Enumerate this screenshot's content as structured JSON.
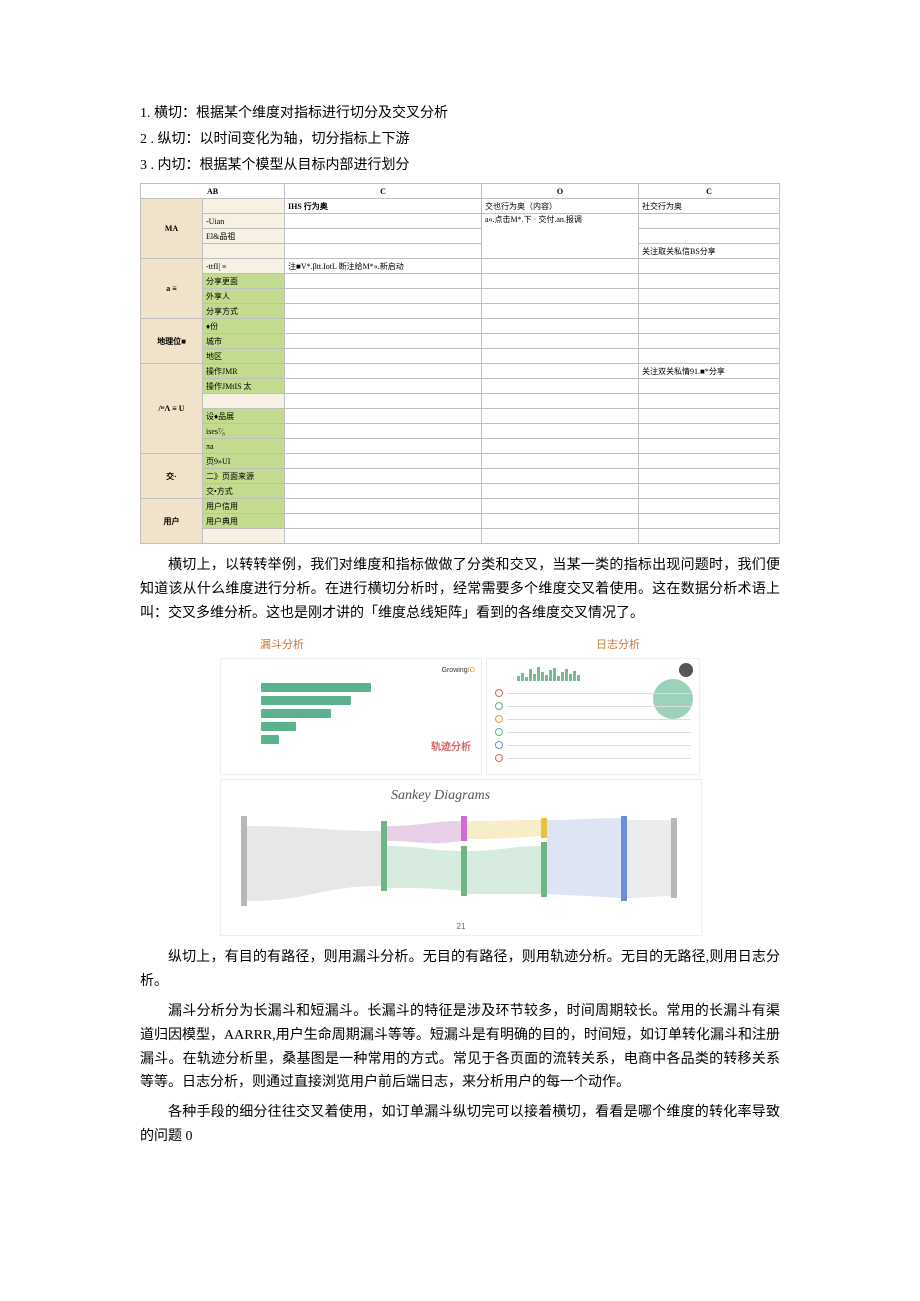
{
  "list": {
    "item1": "1. 横切：根据某个维度对指标进行切分及交叉分析",
    "item2": "2 . 纵切：以时间变化为轴，切分指标上下游",
    "item3": "3 . 内切：根据某个模型从目标内部进行划分"
  },
  "table": {
    "headers": {
      "ab": "AB",
      "c1": "C",
      "o": "O",
      "c2": "C"
    },
    "row1": {
      "b": "",
      "c": "IHS 行为奥",
      "o": "交也行为奥（内容）",
      "e": "社交行为奥"
    },
    "row2": {
      "a": "MA",
      "b": "-Uian",
      "c": "",
      "o": "a«.点击M*.下 · 交付.an.报调",
      "e": ""
    },
    "row3": {
      "b": "El&品祖",
      "c": "",
      "o": "",
      "e": ""
    },
    "row4": {
      "b": "",
      "c": "",
      "o": "",
      "e": "关注取关私信BS分享"
    },
    "row5": {
      "a": "a ≡",
      "b": "-ttfI| ≡",
      "c": "注■V*.βtt.IotL 断注给M*«.新启动",
      "o": "",
      "e": ""
    },
    "row6": {
      "b": "分享更面",
      "c": "",
      "o": "",
      "e": ""
    },
    "row7": {
      "b": "外享人",
      "c": "",
      "o": "",
      "e": ""
    },
    "row8": {
      "b": "分享方式",
      "c": "",
      "o": "",
      "e": ""
    },
    "row9": {
      "a": "地理位■",
      "b": "♦份",
      "c": "",
      "o": "",
      "e": ""
    },
    "row10": {
      "b": "城市",
      "c": "",
      "o": "",
      "e": ""
    },
    "row11": {
      "b": "地区",
      "c": "",
      "o": "",
      "e": ""
    },
    "row12": {
      "a": "/ᵗᵉΛ ≡ U",
      "b": "操作JMR",
      "c": "",
      "o": "",
      "e": "关注双关私情91.■*分享"
    },
    "row13": {
      "b": "操作JMtIS 太",
      "c": "",
      "o": "",
      "e": ""
    },
    "row14": {
      "b": "",
      "c": "",
      "o": "",
      "e": ""
    },
    "row15": {
      "b": "设♦品展",
      "c": "",
      "o": "",
      "e": ""
    },
    "row16": {
      "b": "ises⁷⁄₈",
      "c": "",
      "o": "",
      "e": ""
    },
    "row17": {
      "b": "πa",
      "c": "",
      "o": "",
      "e": ""
    },
    "row18": {
      "a": "交·",
      "b": "页9»UI",
      "c": "",
      "o": "",
      "e": ""
    },
    "row19": {
      "b": "二》页面来源",
      "c": "",
      "o": "",
      "e": ""
    },
    "row20": {
      "b": "交•方式",
      "c": "",
      "o": "",
      "e": ""
    },
    "row21": {
      "a": "用户",
      "b": "用户信用",
      "c": "",
      "o": "",
      "e": ""
    },
    "row22": {
      "b": "用户典用",
      "c": "",
      "o": "",
      "e": ""
    },
    "row23": {
      "b": "",
      "c": "",
      "o": "",
      "e": ""
    }
  },
  "para1": "横切上，以转转举例，我们对维度和指标做做了分类和交叉，当某一类的指标出现问题时，我们便知道该从什么维度进行分析。在进行横切分析时，经常需要多个维度交叉着使用。这在数据分析术语上叫：交叉多维分析。这也是刚才讲的「维度总线矩阵」看到的各维度交叉情况了。",
  "figure": {
    "title_left": "漏斗分析",
    "title_right": "日志分析",
    "growing_label": "Growing",
    "growing_io": "IO",
    "traj_label": "轨迹分析",
    "sankey_title": "Sankey Diagrams",
    "page_num": "21"
  },
  "para2": "纵切上，有目的有路径，则用漏斗分析。无目的有路径，则用轨迹分析。无目的无路径,则用日志分析。",
  "para3": "漏斗分析分为长漏斗和短漏斗。长漏斗的特征是涉及环节较多，时间周期较长。常用的长漏斗有渠道归因模型，AARRR,用户生命周期漏斗等等。短漏斗是有明确的目的，时间短，如订单转化漏斗和注册漏斗。在轨迹分析里，桑基图是一种常用的方式。常见于各页面的流转关系，电商中各品类的转移关系等等。日志分析，则通过直接浏览用户前后端日志，来分析用户的每一个动作。",
  "para4": "各种手段的细分往往交叉着使用，如订单漏斗纵切完可以接着横切，看看是哪个维度的转化率导致的问题 0"
}
